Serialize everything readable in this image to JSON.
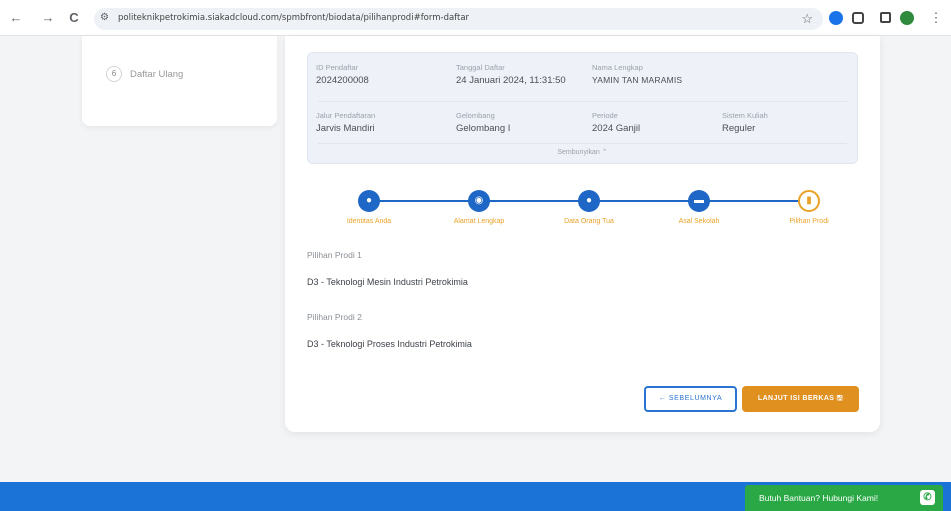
{
  "browser": {
    "back_icon": "←",
    "forward_icon": "→",
    "reload_icon": "C",
    "url": "politeknikpetrokimia.siakadcloud.com/spmbfront/biodata/pilihanprodi#form-daftar",
    "star_icon": "☆"
  },
  "sidebar": {
    "items": [
      {
        "number": "6",
        "label": "Daftar Ulang"
      }
    ]
  },
  "info": {
    "id_label": "ID Pendaftar",
    "id_value": "2024200008",
    "date_label": "Tanggal Daftar",
    "date_value": "24 Januari 2024, 11:31:50",
    "name_label": "Nama Lengkap",
    "name_value": "YAMIN TAN MARAMIS",
    "jalur_label": "Jalur Pendaftaran",
    "jalur_value": "Jarvis Mandiri",
    "gelombang_label": "Gelombang",
    "gelombang_value": "Gelombang I",
    "periode_label": "Periode",
    "periode_value": "2024 Ganjil",
    "sistem_label": "Sistem Kuliah",
    "sistem_value": "Reguler",
    "hide_label": "Sembunyikan ⌃"
  },
  "steps": [
    {
      "label": "Identitas Anda",
      "icon": "person-icon",
      "glyph": "●"
    },
    {
      "label": "Alamat Lengkap",
      "icon": "location-pin-icon",
      "glyph": "◉"
    },
    {
      "label": "Data Orang Tua",
      "icon": "parents-icon",
      "glyph": "●"
    },
    {
      "label": "Asal Sekolah",
      "icon": "school-icon",
      "glyph": "▬"
    },
    {
      "label": "Pilihan Prodi",
      "icon": "book-icon",
      "glyph": "▮"
    }
  ],
  "choices": {
    "first_label": "Pilihan Prodi 1",
    "first_value": "D3 - Teknologi Mesin Industri Petrokimia",
    "second_label": "Pilihan Prodi 2",
    "second_value": "D3 - Teknologi Proses Industri Petrokimia"
  },
  "buttons": {
    "prev_label": "← SEBELUMNYA",
    "next_label": "LANJUT ISI BERKAS  🖫"
  },
  "help": {
    "label": "Butuh Bantuan? Hubungi Kami!",
    "icon": "whatsapp-icon"
  },
  "colors": {
    "primary": "#1f67c7",
    "accent": "#e0901f",
    "footer": "#1b73d8",
    "help": "#2aa846"
  }
}
